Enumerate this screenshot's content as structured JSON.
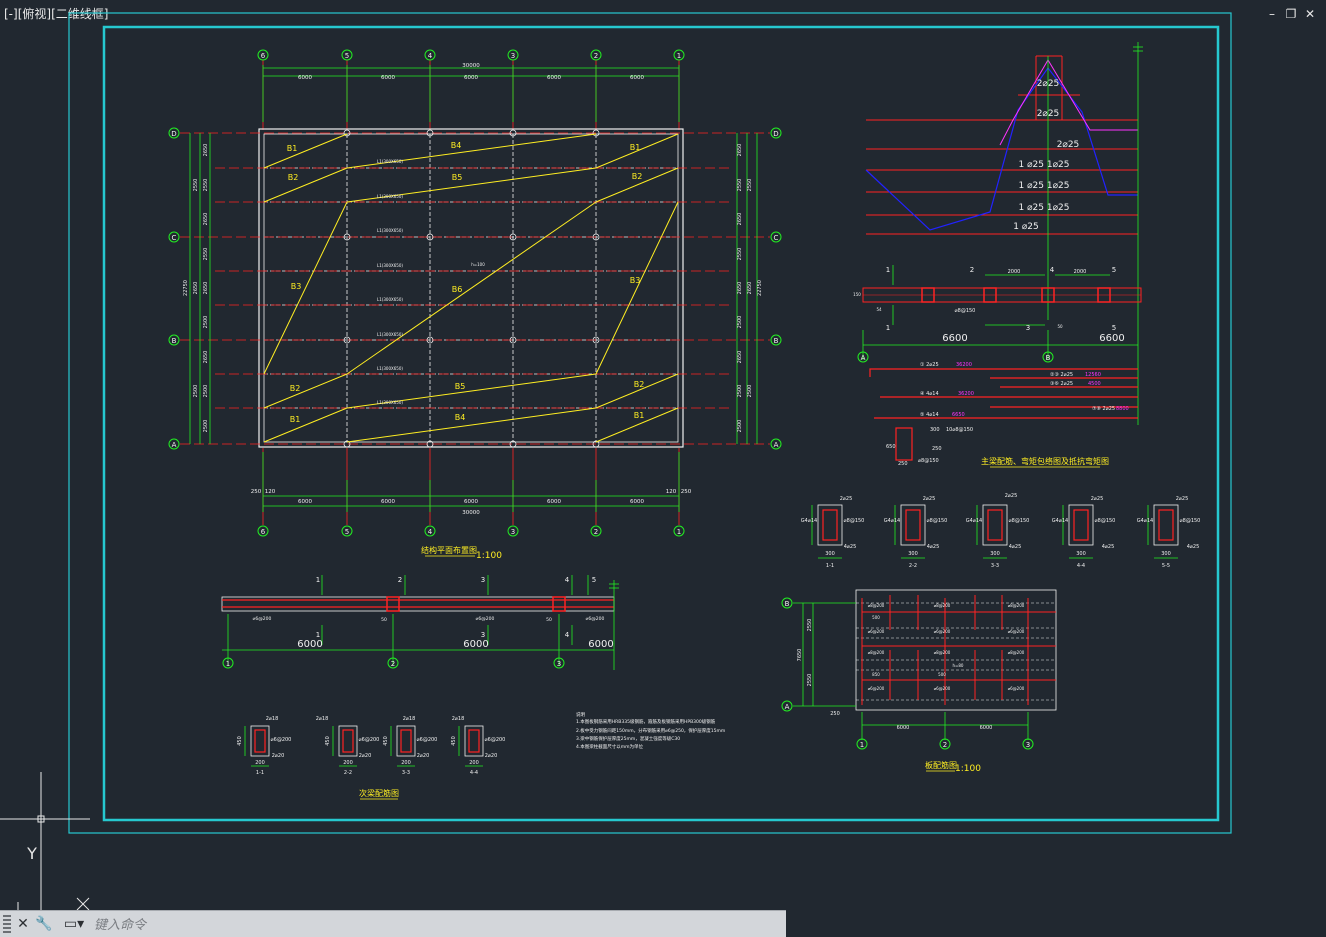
{
  "viewport": {
    "minus": "[-]",
    "view": "[俯视]",
    "style": "[二维线框]"
  },
  "window_controls": {
    "minimize": "–",
    "restore": "❐",
    "close": "✕"
  },
  "ucs": {
    "y_label": "Y"
  },
  "plan": {
    "title": "结构平面布置图",
    "scale": "1:100",
    "top_dims": [
      "6000",
      "6000",
      "6000",
      "6000",
      "6000"
    ],
    "overall_dim": "30000",
    "bottom_left_edge": "250",
    "bottom_left_offset": "120",
    "bottom_right_offset": "120",
    "bottom_right_edge": "250",
    "col_axes": [
      "6",
      "5",
      "4",
      "3",
      "2",
      "1"
    ],
    "row_axes": [
      "D",
      "C",
      "B",
      "A"
    ],
    "left_dims": [
      "2650",
      "2550",
      "2650",
      "2550",
      "2650",
      "2500",
      "2650",
      "2500",
      "2500"
    ],
    "right_dims": [
      "2650",
      "2550",
      "2650",
      "2550",
      "2650",
      "2500",
      "2650",
      "2500",
      "2500"
    ],
    "overall_vert": "22750",
    "beam_label": "L1(300X650)",
    "slab_note": "h=100",
    "slab_labels": {
      "b1": "B1",
      "b2": "B2",
      "b3": "B3",
      "b4": "B4",
      "b5": "B5",
      "b6": "B6"
    }
  },
  "main_beam": {
    "title": "主梁配筋、弯矩包络图及抵抗弯矩图",
    "span_left": "6600",
    "span_right": "6600",
    "axis_a": "A",
    "axis_b": "B",
    "top_bars_1": "2⌀25",
    "top_bars_2": "2⌀25",
    "top_bars_3": "2⌀25",
    "row_labels": [
      "1 ⌀25  1⌀25",
      "1 ⌀25  1⌀25",
      "1 ⌀25  1⌀25",
      "1 ⌀25"
    ],
    "sec_marks": [
      "1",
      "2",
      "3",
      "4",
      "5"
    ],
    "sub_dims": [
      "2000",
      "2000"
    ],
    "stir_note": "⌀8@150",
    "bars": [
      {
        "label": "① 2⌀25",
        "len": "36200"
      },
      {
        "label": "②③ 2⌀25",
        "len": "12560"
      },
      {
        "label": "③⑥ 2⌀25",
        "len": "4500"
      },
      {
        "label": "④ 4⌀14",
        "len": "36200"
      },
      {
        "label": "⑤ 4⌀14",
        "len": "6650"
      },
      {
        "label": "⑦⑧ 2⌀25",
        "len": "8800"
      }
    ],
    "stirrup_dims": [
      "300",
      "650",
      "250"
    ],
    "hook_note": "10⌀8@150",
    "small_notes": [
      "150",
      "54",
      "50"
    ]
  },
  "main_beam_sections": {
    "top": "2⌀25",
    "side": "G4⌀14",
    "stirrup": "⌀8@150",
    "bottom": "4⌀25",
    "width": "300",
    "height": "650",
    "names": [
      "1-1",
      "2-2",
      "3-3",
      "4-4",
      "5-5"
    ]
  },
  "secondary_beam": {
    "title": "次梁配筋图",
    "spans": [
      "6000",
      "6000",
      "6000"
    ],
    "axes": [
      "1",
      "2",
      "3"
    ],
    "sec_marks": [
      "1",
      "2",
      "3",
      "4",
      "5"
    ],
    "stir": "⌀6@200",
    "note_50": "50",
    "sec_top": "2⌀18",
    "sec_bot": "2⌀20",
    "sec_w": "200",
    "sec_h": "450",
    "sec_names": [
      "1-1",
      "2-2",
      "3-3",
      "4-4"
    ]
  },
  "notes": {
    "heading": "说明",
    "lines": [
      "1.本图板钢筋采用HRB335级钢筋，箍筋及板钢筋采用HPB300级钢筋",
      "2.板中受力钢筋间距150mm，分布钢筋采用⌀6@250，保护层厚度15mm",
      "3.梁中钢筋保护层厚度25mm，混凝土强度等级C30",
      "4.本图梁柱截面尺寸以mm为单位"
    ]
  },
  "slab": {
    "title": "板配筋图",
    "scale": "1:100",
    "axes_rows": [
      "B",
      "A"
    ],
    "axes_cols": [
      "1",
      "2",
      "3"
    ],
    "col_dims": [
      "6000",
      "6000"
    ],
    "left_dims": [
      "2550",
      "2550"
    ],
    "overall": "7650",
    "edge": "250",
    "rebar_a": "⌀8@200",
    "rebar_b": "⌀6@200",
    "length_a": "500",
    "length_b": "850",
    "h_note": "h=80"
  },
  "command": {
    "placeholder": "键入命令"
  },
  "colors": {
    "background": "#212830",
    "frame": "#26c8cf",
    "red": "#ff2222",
    "green": "#22ee22",
    "yellow": "#ffee22",
    "white": "#f0f0f0",
    "magenta": "#ff33ff",
    "blue": "#2222ff"
  }
}
